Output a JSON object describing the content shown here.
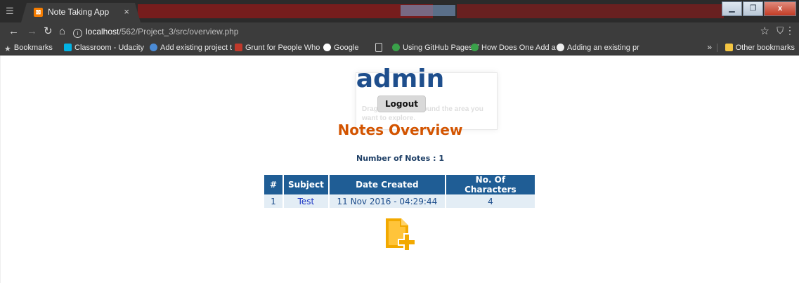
{
  "browser": {
    "tab": {
      "title": "Note Taking App",
      "close": "×"
    },
    "address": {
      "host": "localhost",
      "path": "/562/Project_3/src/overview.php"
    },
    "window_controls": {
      "minimize": "▁",
      "maximize": "❐",
      "close": "x"
    },
    "bookmarks": [
      {
        "label": "Bookmarks",
        "icon": "star-icon",
        "color": "#cfcfcf"
      },
      {
        "label": "Classroom - Udacity",
        "icon": "udacity-icon",
        "color": "#02b3e4"
      },
      {
        "label": "Add existing project t",
        "icon": "gitlab-icon",
        "color": "#4b8bd6"
      },
      {
        "label": "Grunt for People Who",
        "icon": "grunt-icon",
        "color": "#c0392b"
      },
      {
        "label": "Google",
        "icon": "google-icon",
        "color": "#ffffff"
      },
      {
        "label": "",
        "icon": "page-icon",
        "color": "#cfcfcf"
      },
      {
        "label": "Using GitHub Pages T",
        "icon": "leaf-icon",
        "color": "#3aa14a"
      },
      {
        "label": "How Does One Add a",
        "icon": "leaf-icon",
        "color": "#3aa14a"
      },
      {
        "label": "Adding an existing pr",
        "icon": "github-icon",
        "color": "#eeeeee"
      }
    ],
    "bookmarks_more": "»",
    "other_bookmarks": "Other bookmarks"
  },
  "page": {
    "user": "admin",
    "logout_label": "Logout",
    "heading": "Notes Overview",
    "notes_count_label": "Number of Notes : 1",
    "table": {
      "headers": [
        "#",
        "Subject",
        "Date Created",
        "No. Of Characters"
      ],
      "rows": [
        {
          "num": "1",
          "subject": "Test",
          "date": "11 Nov 2016 - 04:29:44",
          "chars": "4"
        }
      ]
    },
    "ghost_tooltip": "Drag the cursor around the area you want to explore."
  },
  "colors": {
    "title": "#1e4e8c",
    "heading": "#d35400",
    "table_header": "#1f5d95",
    "table_row": "#e3edf5",
    "add_icon": "#f2a900"
  }
}
